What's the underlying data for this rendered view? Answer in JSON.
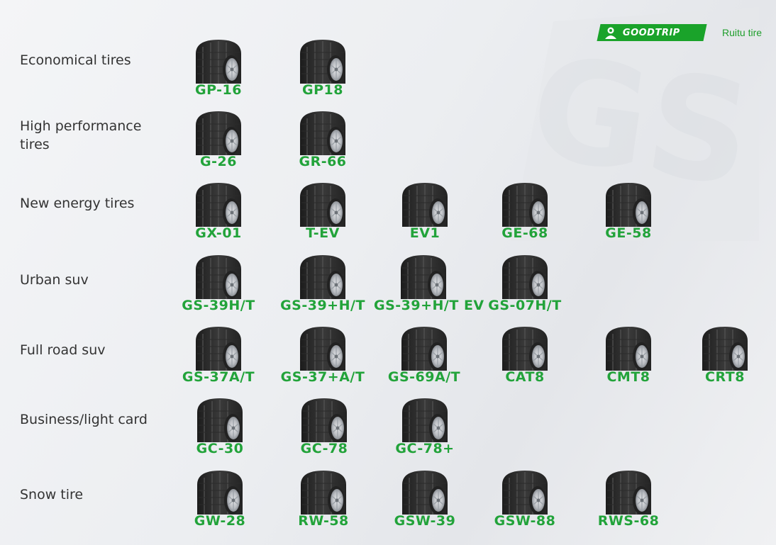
{
  "brand": {
    "logo_text": "GOODTRIP",
    "name": "Ruitu tire",
    "accent_color": "#22a33a"
  },
  "categories": [
    {
      "label": "Economical tires",
      "tires": [
        "GP-16",
        "GP18"
      ]
    },
    {
      "label": "High performance tires",
      "tires": [
        "G-26",
        "GR-66"
      ]
    },
    {
      "label": "New energy tires",
      "tires": [
        "GX-01",
        "T-EV",
        "EV1",
        "GE-68",
        "GE-58"
      ]
    },
    {
      "label": "Urban suv",
      "tires": [
        "GS-39H/T",
        "GS-39+H/T",
        "GS-39+H/T EV",
        "GS-07H/T"
      ]
    },
    {
      "label": "Full road suv",
      "tires": [
        "GS-37A/T",
        "GS-37+A/T",
        "GS-69A/T",
        "CAT8",
        "CMT8",
        "CRT8"
      ]
    },
    {
      "label": "Business/light card",
      "tires": [
        "GC-30",
        "GC-78",
        "GC-78+"
      ]
    },
    {
      "label": "Snow tire",
      "tires": [
        "GW-28",
        "RW-58",
        "GSW-39",
        "GSW-88",
        "RWS-68"
      ]
    }
  ]
}
